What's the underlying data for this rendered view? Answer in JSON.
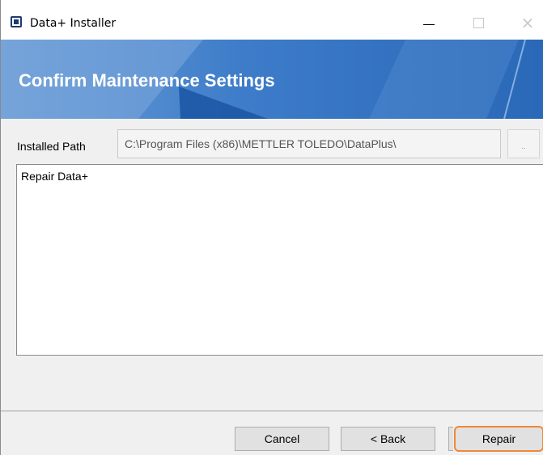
{
  "window": {
    "title": "Data+ Installer"
  },
  "titlebar": {
    "minimize_label": "—",
    "maximize_label": "",
    "close_label": "×"
  },
  "banner": {
    "title": "Confirm Maintenance Settings"
  },
  "installed_path": {
    "label": "Installed Path",
    "value": "C:\\Program Files (x86)\\METTLER TOLEDO\\DataPlus\\",
    "browse_label": ".."
  },
  "summary": {
    "text": "Repair Data+"
  },
  "buttons": {
    "cancel": "Cancel",
    "back": "< Back",
    "repair": "Repair"
  },
  "colors": {
    "banner_gradient_start": "#6e9fd6",
    "banner_gradient_end": "#2a68b8",
    "highlight_outline": "#f0883a"
  }
}
